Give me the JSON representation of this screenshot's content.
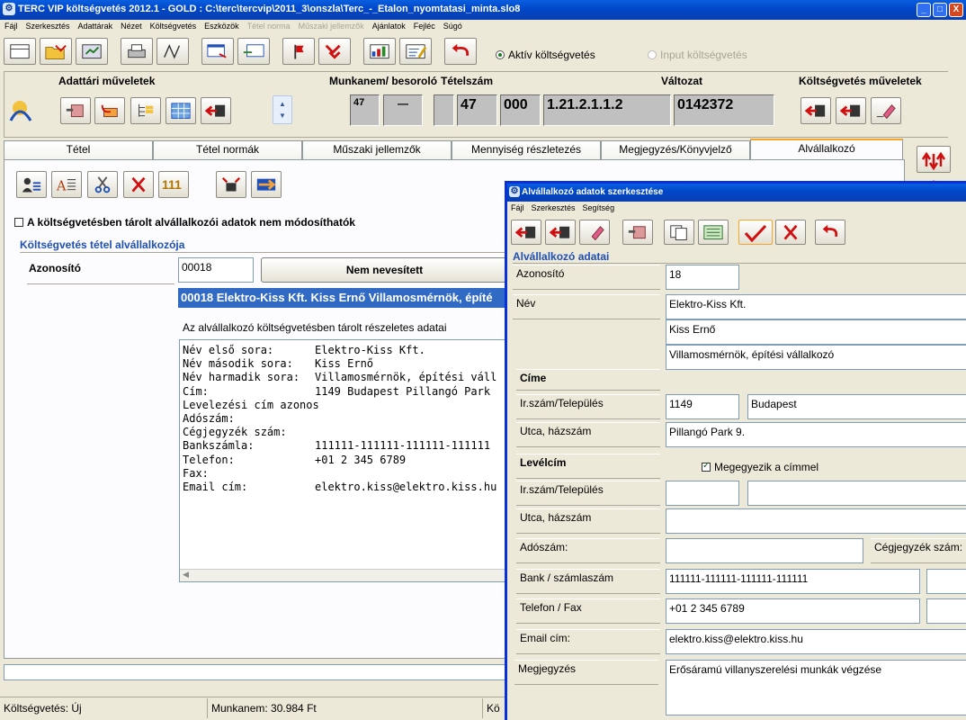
{
  "window": {
    "title": "TERC VIP költségvetés 2012.1 - GOLD :  C:\\terc\\tercvip\\2011_3\\onszla\\Terc_-_Etalon_nyomtatasi_minta.slo8",
    "min": "_",
    "max": "□",
    "close": "X"
  },
  "menu": [
    "Fájl",
    "Szerkesztés",
    "Adattárak",
    "Nézet",
    "Költségvetés",
    "Eszközök",
    "Tétel norma",
    "Műszaki jellemzők",
    "Ajánlatok",
    "Fejléc",
    "Súgó"
  ],
  "toolbar": {
    "radio_active": "Aktív költségvetés",
    "radio_input": "Input költségvetés"
  },
  "sections": {
    "adattari": "Adattári műveletek",
    "munkanem": "Munkanem/ besoroló",
    "tetelszam": "Tételszám",
    "valtozat": "Változat",
    "kv_muveletek": "Költségvetés műveletek"
  },
  "codes": {
    "c1": "47",
    "c2": "—",
    "c3": "",
    "c4": "47",
    "c5": "000",
    "c6": "1.21.2.1.1.2",
    "c7": "0142372"
  },
  "tabs": [
    "Tétel",
    "Tétel normák",
    "Műszaki jellemzők",
    "Mennyiség részletezés",
    "Megjegyzés/Könyvjelző",
    "Alvállalkozó"
  ],
  "subtoolbar": {
    "num": "111"
  },
  "panel": {
    "locked_checkbox": "A költségvetésben tárolt alvállalkozói adatok nem módosíthatók",
    "section_title": "Költségvetés tétel alvállalkozója",
    "id_label": "Azonosító",
    "id_value": "00018",
    "unnamed_button": "Nem nevesített",
    "selected_line": "00018 Elektro-Kiss Kft. Kiss Ernő Villamosmérnök, építé",
    "detail_caption": "Az alvállalkozó költségvetésben tárolt részeletes adatai",
    "details": [
      [
        "Név első sora:",
        "Elektro-Kiss Kft."
      ],
      [
        "Név második sora:",
        "Kiss Ernő"
      ],
      [
        "Név harmadik sora:",
        "Villamosmérnök, építési váll"
      ],
      [
        "Cím:",
        "1149 Budapest Pillangó Park"
      ],
      [
        "Levelezési cím azonos",
        ""
      ],
      [
        "Adószám:",
        ""
      ],
      [
        "Cégjegyzék szám:",
        ""
      ],
      [
        "Bankszámla:",
        "111111-111111-111111-111111"
      ],
      [
        "Telefon:",
        "+01 2 345 6789"
      ],
      [
        "Fax:",
        ""
      ],
      [
        "Email cím:",
        "elektro.kiss@elektro.kiss.hu"
      ]
    ]
  },
  "status": {
    "s1": "Költségvetés: Új",
    "s2": "Munkanem: 30.984 Ft",
    "s3": "Kö"
  },
  "dialog": {
    "title": "Alvállalkozó adatok szerkesztése",
    "menu": [
      "Fájl",
      "Szerkesztés",
      "Segítség"
    ],
    "section": "Alvállalkozó adatai",
    "labels": {
      "azonosito": "Azonosító",
      "nev": "Név",
      "cime": "Címe",
      "irszam": "Ir.szám/Település",
      "utca": "Utca, házszám",
      "levelcim": "Levélcím",
      "irszam2": "Ir.szám/Település",
      "utca2": "Utca, házszám",
      "adoszam": "Adószám:",
      "cegjegyzek": "Cégjegyzék szám:",
      "bank": "Bank / számlaszám",
      "telefon": "Telefon / Fax",
      "email": "Email cím:",
      "megjegyzes": "Megjegyzés"
    },
    "values": {
      "azonosito": "18",
      "nev1": "Elektro-Kiss Kft.",
      "nev2": "Kiss Ernő",
      "nev3": "Villamosmérnök, építési vállalkozó",
      "irszam": "1149",
      "telepules": "Budapest",
      "utca": "Pillangó Park 9.",
      "megegyezik": "Megegyezik a címmel",
      "irszam2": "",
      "telepules2": "",
      "utca2": "",
      "adoszam": "",
      "bank": "111111-111111-111111-111111",
      "telefon": "+01 2 345 6789",
      "email": "elektro.kiss@elektro.kiss.hu",
      "megjegyzes": "Erősáramú villanyszerelési munkák végzése"
    }
  },
  "colors": {
    "accent": "#0a5fe0",
    "section_blue": "#1f4fb8",
    "highlight": "#316ac5",
    "red": "#d01010"
  }
}
